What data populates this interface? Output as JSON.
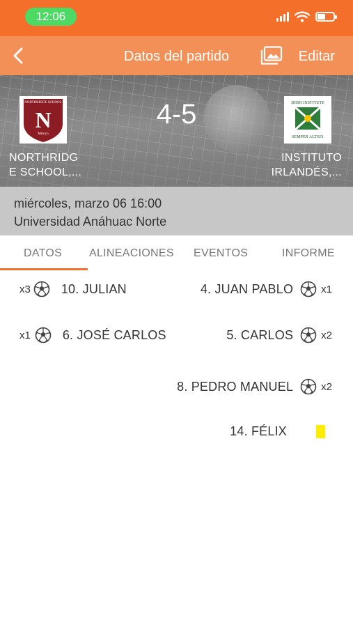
{
  "status_bar": {
    "time": "12:06"
  },
  "nav": {
    "title": "Datos del partido",
    "edit_label": "Editar"
  },
  "match": {
    "home_team": "NORTHRIDGE SCHOOL,...",
    "home_team_line1": "NORTHRIDG",
    "home_team_line2": "E SCHOOL,...",
    "away_team_line1": "INSTITUTO",
    "away_team_line2": "IRLANDÉS,...",
    "score": "4-5",
    "date": "miércoles, marzo 06 16:00",
    "venue": "Universidad Anáhuac Norte",
    "home_logo_text": {
      "top": "NORTHRIDGE SCHOOL",
      "letter": "N",
      "bottom": "México"
    },
    "away_logo_text": {
      "top": "IRISH INSTITUTE",
      "bottom": "SEMPER ALTIUS"
    }
  },
  "tabs": [
    {
      "label": "DATOS",
      "active": true
    },
    {
      "label": "ALINEACIONES",
      "active": false
    },
    {
      "label": "EVENTOS",
      "active": false
    },
    {
      "label": "INFORME",
      "active": false
    }
  ],
  "events": {
    "home": [
      {
        "player": "10. JULIAN",
        "type": "goal",
        "count": "x3"
      },
      {
        "player": "6. JOSÉ CARLOS",
        "type": "goal",
        "count": "x1"
      }
    ],
    "away": [
      {
        "player": "4. JUAN PABLO",
        "type": "goal",
        "count": "x1"
      },
      {
        "player": "5. CARLOS",
        "type": "goal",
        "count": "x2"
      },
      {
        "player": "8. PEDRO MANUEL",
        "type": "goal",
        "count": "x2"
      },
      {
        "player": "14. FÉLIX",
        "type": "yellow-card",
        "count": ""
      }
    ]
  },
  "colors": {
    "status_bar": "#f36f2a",
    "nav_bar": "#f39058",
    "accent": "#f36f2a",
    "time_pill": "#4cd964",
    "yellow_card": "#ffed00"
  }
}
